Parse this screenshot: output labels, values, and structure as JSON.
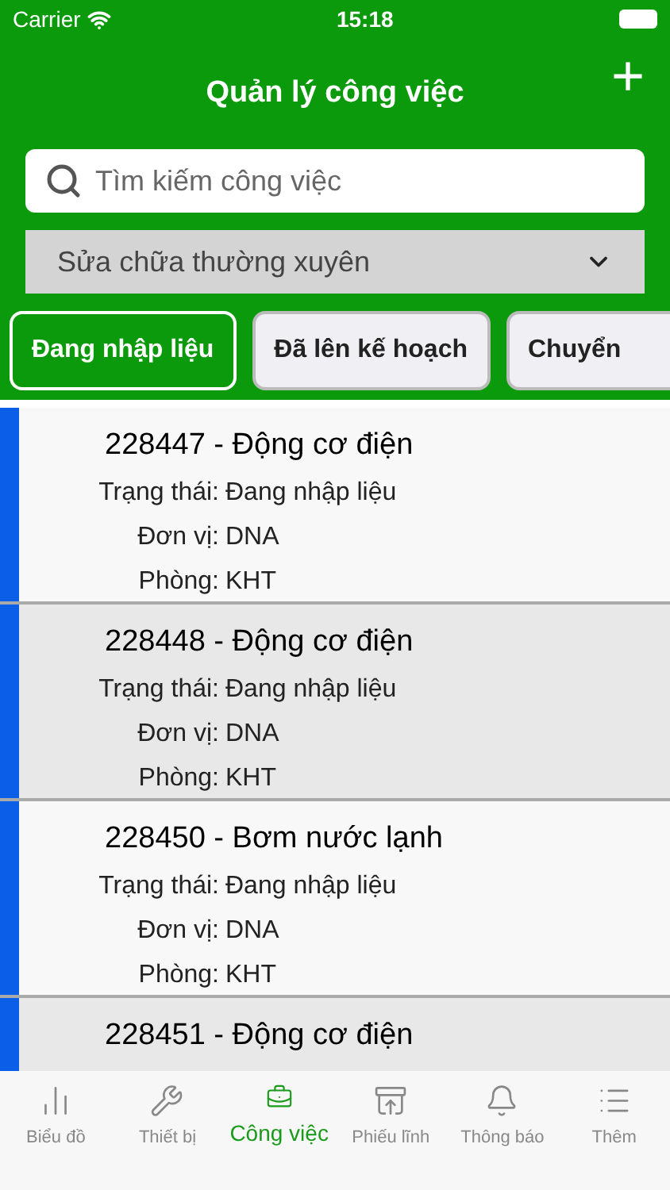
{
  "status_bar": {
    "carrier": "Carrier",
    "time": "15:18"
  },
  "header": {
    "title": "Quản lý công việc",
    "add_button": "+"
  },
  "search": {
    "placeholder": "Tìm kiếm công việc"
  },
  "category_dropdown": {
    "value": "Sửa chữa thường xuyên"
  },
  "filter_chips": [
    {
      "label": "Đang nhập liệu",
      "selected": true
    },
    {
      "label": "Đã lên kế hoạch",
      "selected": false
    },
    {
      "label": "Chuyển",
      "selected": false
    }
  ],
  "jobs": [
    {
      "title": "228447 - Động cơ điện",
      "fields": [
        {
          "label": "Trạng thái:",
          "value": "Đang nhập liệu"
        },
        {
          "label": "Đơn vị:",
          "value": "DNA"
        },
        {
          "label": "Phòng:",
          "value": "KHT"
        }
      ]
    },
    {
      "title": "228448 - Động cơ điện",
      "fields": [
        {
          "label": "Trạng thái:",
          "value": "Đang nhập liệu"
        },
        {
          "label": "Đơn vị:",
          "value": "DNA"
        },
        {
          "label": "Phòng:",
          "value": "KHT"
        }
      ]
    },
    {
      "title": "228450 - Bơm nước lạnh",
      "fields": [
        {
          "label": "Trạng thái:",
          "value": "Đang nhập liệu"
        },
        {
          "label": "Đơn vị:",
          "value": "DNA"
        },
        {
          "label": "Phòng:",
          "value": "KHT"
        }
      ]
    },
    {
      "title": "228451 - Động cơ điện"
    }
  ],
  "tab_bar": [
    {
      "label": "Biểu đồ",
      "kind": "chart",
      "selected": false
    },
    {
      "label": "Thiết bị",
      "kind": "tools",
      "selected": false
    },
    {
      "label": "Công việc",
      "kind": "briefcase",
      "selected": true
    },
    {
      "label": "Phiếu lĩnh",
      "kind": "archive",
      "selected": false
    },
    {
      "label": "Thông báo",
      "kind": "bell",
      "selected": false
    },
    {
      "label": "Thêm",
      "kind": "list",
      "selected": false
    }
  ]
}
